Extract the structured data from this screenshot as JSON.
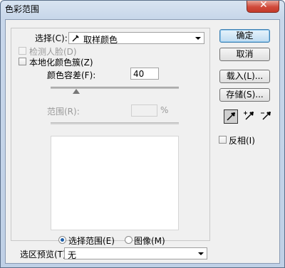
{
  "window": {
    "title": "色彩范围",
    "close_symbol": "✕"
  },
  "select": {
    "label": "选择(C):",
    "value": "取样颜色"
  },
  "detect_faces": {
    "label": "检测人脸(D)",
    "checked": false
  },
  "localized": {
    "label": "本地化颜色簇(Z)",
    "checked": false
  },
  "fuzziness": {
    "label": "颜色容差(F):",
    "value": "40",
    "level_percent": 20
  },
  "range": {
    "label": "范围(R):",
    "value": "",
    "unit": "%"
  },
  "view": {
    "selection_label": "选择范围(E)",
    "image_label": "图像(M)",
    "selected": "selection"
  },
  "preview": {
    "label": "选区预览(T):",
    "value": "无"
  },
  "buttons": {
    "ok": "确定",
    "cancel": "取消",
    "load": "载入(L)...",
    "save": "存储(S)..."
  },
  "eyedroppers": [
    {
      "name": "eyedropper-icon",
      "selected": true
    },
    {
      "name": "eyedropper-plus-icon",
      "selected": false
    },
    {
      "name": "eyedropper-minus-icon",
      "selected": false
    }
  ],
  "invert": {
    "label": "反相(I)",
    "checked": false
  }
}
